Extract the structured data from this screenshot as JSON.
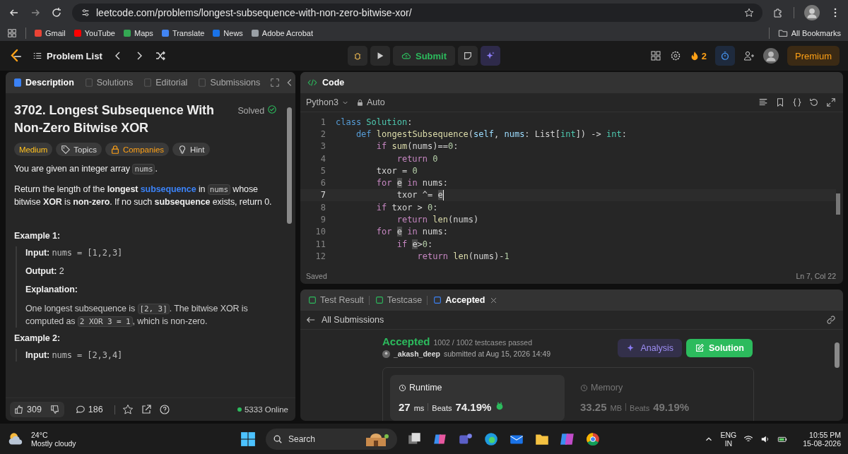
{
  "browser": {
    "url": "leetcode.com/problems/longest-subsequence-with-non-zero-bitwise-xor/",
    "bookmarks": [
      {
        "label": "Gmail",
        "color": "#ea4335"
      },
      {
        "label": "YouTube",
        "color": "#ff0000"
      },
      {
        "label": "Maps",
        "color": "#34a853"
      },
      {
        "label": "Translate",
        "color": "#4285f4"
      },
      {
        "label": "News",
        "color": "#1a73e8"
      },
      {
        "label": "Adobe Acrobat",
        "color": "#9aa0a6"
      }
    ],
    "all_bookmarks": "All Bookmarks"
  },
  "nav": {
    "problem_list": "Problem List",
    "submit": "Submit",
    "streak": "2",
    "premium": "Premium"
  },
  "description_panel": {
    "tabs": [
      {
        "label": "Description",
        "selected": true
      },
      {
        "label": "Solutions",
        "selected": false
      },
      {
        "label": "Editorial",
        "selected": false
      },
      {
        "label": "Submissions",
        "selected": false
      }
    ],
    "title": "3702. Longest Subsequence With Non-Zero Bitwise XOR",
    "status": "Solved",
    "tags": [
      {
        "label": "Medium",
        "kind": "difficulty"
      },
      {
        "label": "Topics",
        "kind": "topics"
      },
      {
        "label": "Companies",
        "kind": "companies"
      },
      {
        "label": "Hint",
        "kind": "hint"
      }
    ],
    "paragraphs": [
      [
        {
          "kind": "text",
          "text": "You are given an integer array "
        },
        {
          "kind": "code",
          "text": "nums"
        },
        {
          "kind": "text",
          "text": "."
        }
      ],
      [
        {
          "kind": "text",
          "text": "Return the length of the "
        },
        {
          "kind": "bold",
          "text": "longest "
        },
        {
          "kind": "link",
          "text": "subsequence"
        },
        {
          "kind": "text",
          "text": " in "
        },
        {
          "kind": "code",
          "text": "nums"
        },
        {
          "kind": "text",
          "text": " whose bitwise "
        },
        {
          "kind": "bold",
          "text": "XOR"
        },
        {
          "kind": "text",
          "text": " is "
        },
        {
          "kind": "bold",
          "text": "non-zero"
        },
        {
          "kind": "text",
          "text": ". If no such "
        },
        {
          "kind": "bold",
          "text": "subsequence"
        },
        {
          "kind": "text",
          "text": " exists, return 0."
        }
      ]
    ],
    "examples": [
      {
        "title": "Example 1:",
        "lines": [
          {
            "label": "Input:",
            "value": "nums = [1,2,3]",
            "kind": "code"
          },
          {
            "label": "Output:",
            "value": "2",
            "kind": "text"
          }
        ],
        "explanation_label": "Explanation:",
        "explanation": [
          {
            "kind": "text",
            "text": "One longest subsequence is "
          },
          {
            "kind": "code",
            "text": "[2, 3]"
          },
          {
            "kind": "text",
            "text": ". The bitwise XOR is computed as "
          },
          {
            "kind": "code",
            "text": "2 XOR 3 = 1"
          },
          {
            "kind": "text",
            "text": ", which is non-zero."
          }
        ]
      },
      {
        "title": "Example 2:",
        "lines": [
          {
            "label": "Input:",
            "value": "nums = [2,3,4]",
            "kind": "code"
          }
        ]
      }
    ],
    "footer": {
      "likes": "309",
      "comments": "186",
      "online": "5333 Online"
    }
  },
  "editor": {
    "title": "Code",
    "language": "Python3",
    "mode": "Auto",
    "lines": [
      {
        "number": "1",
        "active": false,
        "tokens": [
          {
            "kind": "decl",
            "text": "class"
          },
          {
            "kind": "type",
            "text": " Solution"
          },
          {
            "kind": "plain",
            "text": ":"
          }
        ]
      },
      {
        "number": "2",
        "active": false,
        "tokens": [
          {
            "kind": "decl",
            "text": "    def"
          },
          {
            "kind": "func",
            "text": " longestSubsequence"
          },
          {
            "kind": "plain",
            "text": "("
          },
          {
            "kind": "param",
            "text": "self"
          },
          {
            "kind": "plain",
            "text": ", "
          },
          {
            "kind": "param",
            "text": "nums"
          },
          {
            "kind": "plain",
            "text": ": List["
          },
          {
            "kind": "type",
            "text": "int"
          },
          {
            "kind": "plain",
            "text": "]) -> "
          },
          {
            "kind": "type",
            "text": "int"
          },
          {
            "kind": "plain",
            "text": ":"
          }
        ]
      },
      {
        "number": "3",
        "active": false,
        "tokens": [
          {
            "kind": "keyword",
            "text": "        if"
          },
          {
            "kind": "func",
            "text": " sum"
          },
          {
            "kind": "plain",
            "text": "(nums)=="
          },
          {
            "kind": "number",
            "text": "0"
          },
          {
            "kind": "plain",
            "text": ":"
          }
        ]
      },
      {
        "number": "4",
        "active": false,
        "tokens": [
          {
            "kind": "keyword",
            "text": "            return"
          },
          {
            "kind": "number",
            "text": " 0"
          }
        ]
      },
      {
        "number": "5",
        "active": false,
        "tokens": [
          {
            "kind": "plain",
            "text": "        txor = "
          },
          {
            "kind": "number",
            "text": "0"
          }
        ]
      },
      {
        "number": "6",
        "active": false,
        "tokens": [
          {
            "kind": "keyword",
            "text": "        for "
          },
          {
            "kind": "match",
            "text": "e"
          },
          {
            "kind": "keyword",
            "text": " in"
          },
          {
            "kind": "plain",
            "text": " nums:"
          }
        ]
      },
      {
        "number": "7",
        "active": true,
        "tokens": [
          {
            "kind": "plain",
            "text": "            txor ^= "
          },
          {
            "kind": "match",
            "text": "e"
          }
        ]
      },
      {
        "number": "8",
        "active": false,
        "tokens": [
          {
            "kind": "keyword",
            "text": "        if"
          },
          {
            "kind": "plain",
            "text": " txor > "
          },
          {
            "kind": "number",
            "text": "0"
          },
          {
            "kind": "plain",
            "text": ":"
          }
        ]
      },
      {
        "number": "9",
        "active": false,
        "tokens": [
          {
            "kind": "keyword",
            "text": "            return"
          },
          {
            "kind": "func",
            "text": " len"
          },
          {
            "kind": "plain",
            "text": "(nums)"
          }
        ]
      },
      {
        "number": "10",
        "active": false,
        "tokens": [
          {
            "kind": "keyword",
            "text": "        for "
          },
          {
            "kind": "match",
            "text": "e"
          },
          {
            "kind": "keyword",
            "text": " in"
          },
          {
            "kind": "plain",
            "text": " nums:"
          }
        ]
      },
      {
        "number": "11",
        "active": false,
        "tokens": [
          {
            "kind": "keyword",
            "text": "            if "
          },
          {
            "kind": "match",
            "text": "e"
          },
          {
            "kind": "plain",
            "text": ">"
          },
          {
            "kind": "number",
            "text": "0"
          },
          {
            "kind": "plain",
            "text": ":"
          }
        ]
      },
      {
        "number": "12",
        "active": false,
        "tokens": [
          {
            "kind": "keyword",
            "text": "                return"
          },
          {
            "kind": "func",
            "text": " len"
          },
          {
            "kind": "plain",
            "text": "(nums)-"
          },
          {
            "kind": "number",
            "text": "1"
          }
        ]
      }
    ],
    "status": "Saved",
    "cursor": "Ln 7, Col 22"
  },
  "result_panel": {
    "tabs": [
      {
        "label": "Test Result",
        "selected": false
      },
      {
        "label": "Testcase",
        "selected": false
      },
      {
        "label": "Accepted",
        "selected": true
      }
    ],
    "back": "All Submissions",
    "verdict": "Accepted",
    "testcases": "1002 / 1002 testcases passed",
    "user": "_akash_deep",
    "submitted": "submitted at Aug 15, 2026 14:49",
    "analysis": "Analysis",
    "solution": "Solution",
    "stats": [
      {
        "label": "Runtime",
        "value": "27",
        "unit": "ms",
        "beats_label": "Beats",
        "beats": "74.19%",
        "selected": true
      },
      {
        "label": "Memory",
        "value": "33.25",
        "unit": "MB",
        "beats_label": "Beats",
        "beats": "49.19%",
        "selected": false
      }
    ]
  },
  "taskbar": {
    "temperature": "24°C",
    "weather": "Mostly cloudy",
    "search": "Search",
    "language": "ENG",
    "region": "IN",
    "time": "10:55 PM",
    "date": "15-08-2026"
  }
}
